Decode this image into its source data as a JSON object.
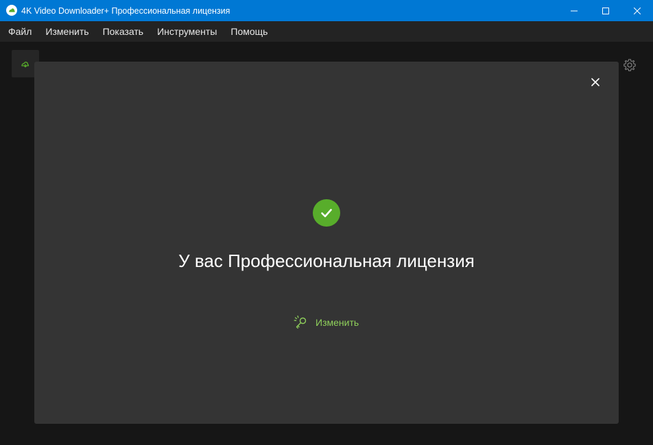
{
  "window": {
    "title": "4K Video Downloader+ Профессиональная лицензия"
  },
  "menu": [
    {
      "label": "Файл"
    },
    {
      "label": "Изменить"
    },
    {
      "label": "Показать"
    },
    {
      "label": "Инструменты"
    },
    {
      "label": "Помощь"
    }
  ],
  "dialog": {
    "title": "У вас Профессиональная лицензия",
    "change_label": "Изменить"
  },
  "icons": {
    "app": "app-logo-icon",
    "minimize": "minimize-icon",
    "maximize": "maximize-icon",
    "close": "close-icon",
    "toolbar": "smart-mode-icon",
    "settings": "gear-icon",
    "dialog_close": "close-icon",
    "status": "checkmark-icon",
    "change": "key-icon"
  },
  "colors": {
    "titlebar": "#0078d4",
    "accent_green": "#58ad2b",
    "link_green": "#8fd05b",
    "modal_bg": "#343434"
  }
}
